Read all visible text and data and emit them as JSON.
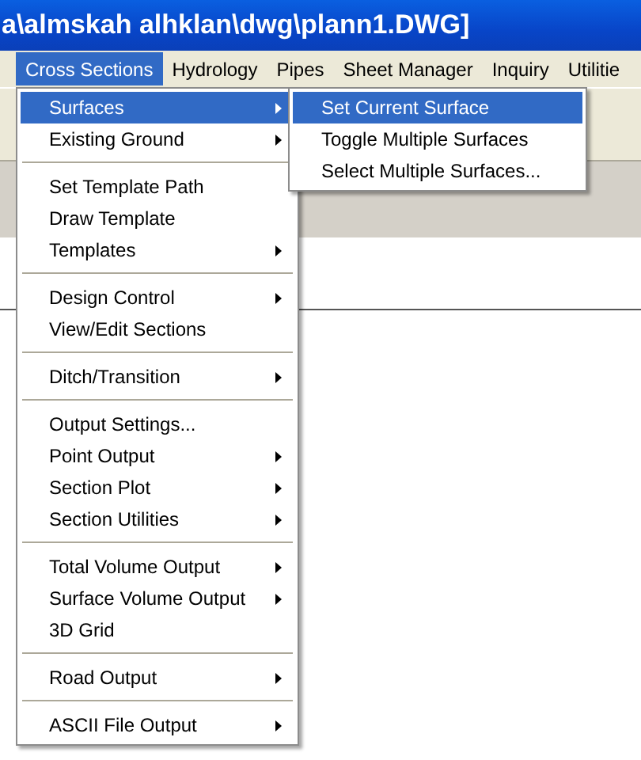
{
  "window": {
    "title": "a\\almskah alhklan\\dwg\\plann1.DWG]"
  },
  "menubar": [
    {
      "label": "Cross Sections",
      "selected": true
    },
    {
      "label": "Hydrology",
      "selected": false
    },
    {
      "label": "Pipes",
      "selected": false
    },
    {
      "label": "Sheet Manager",
      "selected": false
    },
    {
      "label": "Inquiry",
      "selected": false
    },
    {
      "label": "Utilitie",
      "selected": false
    }
  ],
  "menu": {
    "groups": [
      [
        {
          "label": "Surfaces",
          "submenu": true,
          "selected": true
        },
        {
          "label": "Existing Ground",
          "submenu": true,
          "selected": false
        }
      ],
      [
        {
          "label": "Set Template Path",
          "submenu": false,
          "selected": false
        },
        {
          "label": "Draw Template",
          "submenu": false,
          "selected": false
        },
        {
          "label": "Templates",
          "submenu": true,
          "selected": false
        }
      ],
      [
        {
          "label": "Design Control",
          "submenu": true,
          "selected": false
        },
        {
          "label": "View/Edit Sections",
          "submenu": false,
          "selected": false
        }
      ],
      [
        {
          "label": "Ditch/Transition",
          "submenu": true,
          "selected": false
        }
      ],
      [
        {
          "label": "Output Settings...",
          "submenu": false,
          "selected": false
        },
        {
          "label": "Point Output",
          "submenu": true,
          "selected": false
        },
        {
          "label": "Section Plot",
          "submenu": true,
          "selected": false
        },
        {
          "label": "Section Utilities",
          "submenu": true,
          "selected": false
        }
      ],
      [
        {
          "label": "Total Volume Output",
          "submenu": true,
          "selected": false
        },
        {
          "label": "Surface Volume Output",
          "submenu": true,
          "selected": false
        },
        {
          "label": "3D Grid",
          "submenu": false,
          "selected": false
        }
      ],
      [
        {
          "label": "Road Output",
          "submenu": true,
          "selected": false
        }
      ],
      [
        {
          "label": "ASCII File Output",
          "submenu": true,
          "selected": false
        }
      ]
    ]
  },
  "submenu": {
    "groups": [
      [
        {
          "label": "Set Current Surface",
          "submenu": false,
          "selected": true
        },
        {
          "label": "Toggle Multiple Surfaces",
          "submenu": false,
          "selected": false
        },
        {
          "label": "Select Multiple Surfaces...",
          "submenu": false,
          "selected": false
        }
      ]
    ]
  }
}
